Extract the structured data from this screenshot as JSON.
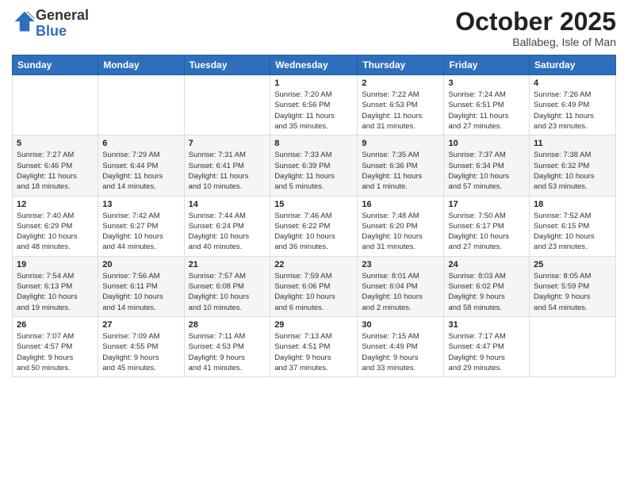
{
  "logo": {
    "general": "General",
    "blue": "Blue"
  },
  "title": "October 2025",
  "location": "Ballabeg, Isle of Man",
  "days_of_week": [
    "Sunday",
    "Monday",
    "Tuesday",
    "Wednesday",
    "Thursday",
    "Friday",
    "Saturday"
  ],
  "weeks": [
    [
      {
        "day": "",
        "info": ""
      },
      {
        "day": "",
        "info": ""
      },
      {
        "day": "",
        "info": ""
      },
      {
        "day": "1",
        "info": "Sunrise: 7:20 AM\nSunset: 6:56 PM\nDaylight: 11 hours\nand 35 minutes."
      },
      {
        "day": "2",
        "info": "Sunrise: 7:22 AM\nSunset: 6:53 PM\nDaylight: 11 hours\nand 31 minutes."
      },
      {
        "day": "3",
        "info": "Sunrise: 7:24 AM\nSunset: 6:51 PM\nDaylight: 11 hours\nand 27 minutes."
      },
      {
        "day": "4",
        "info": "Sunrise: 7:26 AM\nSunset: 6:49 PM\nDaylight: 11 hours\nand 23 minutes."
      }
    ],
    [
      {
        "day": "5",
        "info": "Sunrise: 7:27 AM\nSunset: 6:46 PM\nDaylight: 11 hours\nand 18 minutes."
      },
      {
        "day": "6",
        "info": "Sunrise: 7:29 AM\nSunset: 6:44 PM\nDaylight: 11 hours\nand 14 minutes."
      },
      {
        "day": "7",
        "info": "Sunrise: 7:31 AM\nSunset: 6:41 PM\nDaylight: 11 hours\nand 10 minutes."
      },
      {
        "day": "8",
        "info": "Sunrise: 7:33 AM\nSunset: 6:39 PM\nDaylight: 11 hours\nand 5 minutes."
      },
      {
        "day": "9",
        "info": "Sunrise: 7:35 AM\nSunset: 6:36 PM\nDaylight: 11 hours\nand 1 minute."
      },
      {
        "day": "10",
        "info": "Sunrise: 7:37 AM\nSunset: 6:34 PM\nDaylight: 10 hours\nand 57 minutes."
      },
      {
        "day": "11",
        "info": "Sunrise: 7:38 AM\nSunset: 6:32 PM\nDaylight: 10 hours\nand 53 minutes."
      }
    ],
    [
      {
        "day": "12",
        "info": "Sunrise: 7:40 AM\nSunset: 6:29 PM\nDaylight: 10 hours\nand 48 minutes."
      },
      {
        "day": "13",
        "info": "Sunrise: 7:42 AM\nSunset: 6:27 PM\nDaylight: 10 hours\nand 44 minutes."
      },
      {
        "day": "14",
        "info": "Sunrise: 7:44 AM\nSunset: 6:24 PM\nDaylight: 10 hours\nand 40 minutes."
      },
      {
        "day": "15",
        "info": "Sunrise: 7:46 AM\nSunset: 6:22 PM\nDaylight: 10 hours\nand 36 minutes."
      },
      {
        "day": "16",
        "info": "Sunrise: 7:48 AM\nSunset: 6:20 PM\nDaylight: 10 hours\nand 31 minutes."
      },
      {
        "day": "17",
        "info": "Sunrise: 7:50 AM\nSunset: 6:17 PM\nDaylight: 10 hours\nand 27 minutes."
      },
      {
        "day": "18",
        "info": "Sunrise: 7:52 AM\nSunset: 6:15 PM\nDaylight: 10 hours\nand 23 minutes."
      }
    ],
    [
      {
        "day": "19",
        "info": "Sunrise: 7:54 AM\nSunset: 6:13 PM\nDaylight: 10 hours\nand 19 minutes."
      },
      {
        "day": "20",
        "info": "Sunrise: 7:56 AM\nSunset: 6:11 PM\nDaylight: 10 hours\nand 14 minutes."
      },
      {
        "day": "21",
        "info": "Sunrise: 7:57 AM\nSunset: 6:08 PM\nDaylight: 10 hours\nand 10 minutes."
      },
      {
        "day": "22",
        "info": "Sunrise: 7:59 AM\nSunset: 6:06 PM\nDaylight: 10 hours\nand 6 minutes."
      },
      {
        "day": "23",
        "info": "Sunrise: 8:01 AM\nSunset: 6:04 PM\nDaylight: 10 hours\nand 2 minutes."
      },
      {
        "day": "24",
        "info": "Sunrise: 8:03 AM\nSunset: 6:02 PM\nDaylight: 9 hours\nand 58 minutes."
      },
      {
        "day": "25",
        "info": "Sunrise: 8:05 AM\nSunset: 5:59 PM\nDaylight: 9 hours\nand 54 minutes."
      }
    ],
    [
      {
        "day": "26",
        "info": "Sunrise: 7:07 AM\nSunset: 4:57 PM\nDaylight: 9 hours\nand 50 minutes."
      },
      {
        "day": "27",
        "info": "Sunrise: 7:09 AM\nSunset: 4:55 PM\nDaylight: 9 hours\nand 45 minutes."
      },
      {
        "day": "28",
        "info": "Sunrise: 7:11 AM\nSunset: 4:53 PM\nDaylight: 9 hours\nand 41 minutes."
      },
      {
        "day": "29",
        "info": "Sunrise: 7:13 AM\nSunset: 4:51 PM\nDaylight: 9 hours\nand 37 minutes."
      },
      {
        "day": "30",
        "info": "Sunrise: 7:15 AM\nSunset: 4:49 PM\nDaylight: 9 hours\nand 33 minutes."
      },
      {
        "day": "31",
        "info": "Sunrise: 7:17 AM\nSunset: 4:47 PM\nDaylight: 9 hours\nand 29 minutes."
      },
      {
        "day": "",
        "info": ""
      }
    ]
  ]
}
